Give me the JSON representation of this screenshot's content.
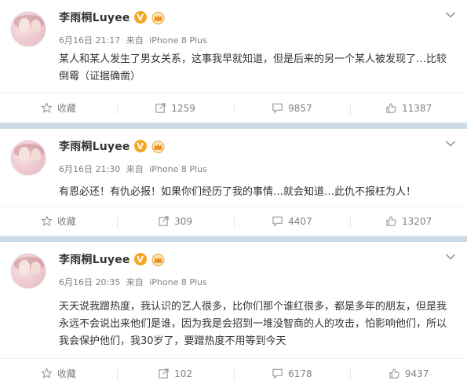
{
  "posts": [
    {
      "username": "李雨桐Luyee",
      "verified_badge": "V",
      "time": "6月16日 21:17",
      "from_label": "来自",
      "device": "iPhone 8 Plus",
      "text": "某人和某人发生了男女关系，这事我早就知道，但是后来的另一个某人被发现了…比较倒霉（证据确凿）",
      "favorite_label": "收藏",
      "repost_count": "1259",
      "comment_count": "9857",
      "like_count": "11387"
    },
    {
      "username": "李雨桐Luyee",
      "verified_badge": "V",
      "time": "6月16日 21:30",
      "from_label": "来自",
      "device": "iPhone 8 Plus",
      "text": "有恩必还！有仇必报！如果你们经历了我的事情…就会知道…此仇不报枉为人！",
      "favorite_label": "收藏",
      "repost_count": "309",
      "comment_count": "4407",
      "like_count": "13207"
    },
    {
      "username": "李雨桐Luyee",
      "verified_badge": "V",
      "time": "6月16日 20:35",
      "from_label": "来自",
      "device": "iPhone 8 Plus",
      "text": "天天说我蹭热度，我认识的艺人很多，比你们那个谁红很多，都是多年的朋友，但是我永远不会说出来他们是谁，因为我是会招到一堆没智商的人的攻击，怕影响他们，所以我会保护他们，我30岁了，要蹭热度不用等到今天",
      "favorite_label": "收藏",
      "repost_count": "102",
      "comment_count": "6178",
      "like_count": "9437"
    }
  ],
  "colors": {
    "accent": "#f5a623",
    "meta": "#808080",
    "separator": "#c9dbe8"
  },
  "icons": {
    "verified": "v-badge-icon",
    "member": "crown-icon",
    "more": "chevron-down-icon",
    "favorite": "star-icon",
    "repost": "repost-icon",
    "comment": "comment-icon",
    "like": "thumbs-up-icon"
  }
}
